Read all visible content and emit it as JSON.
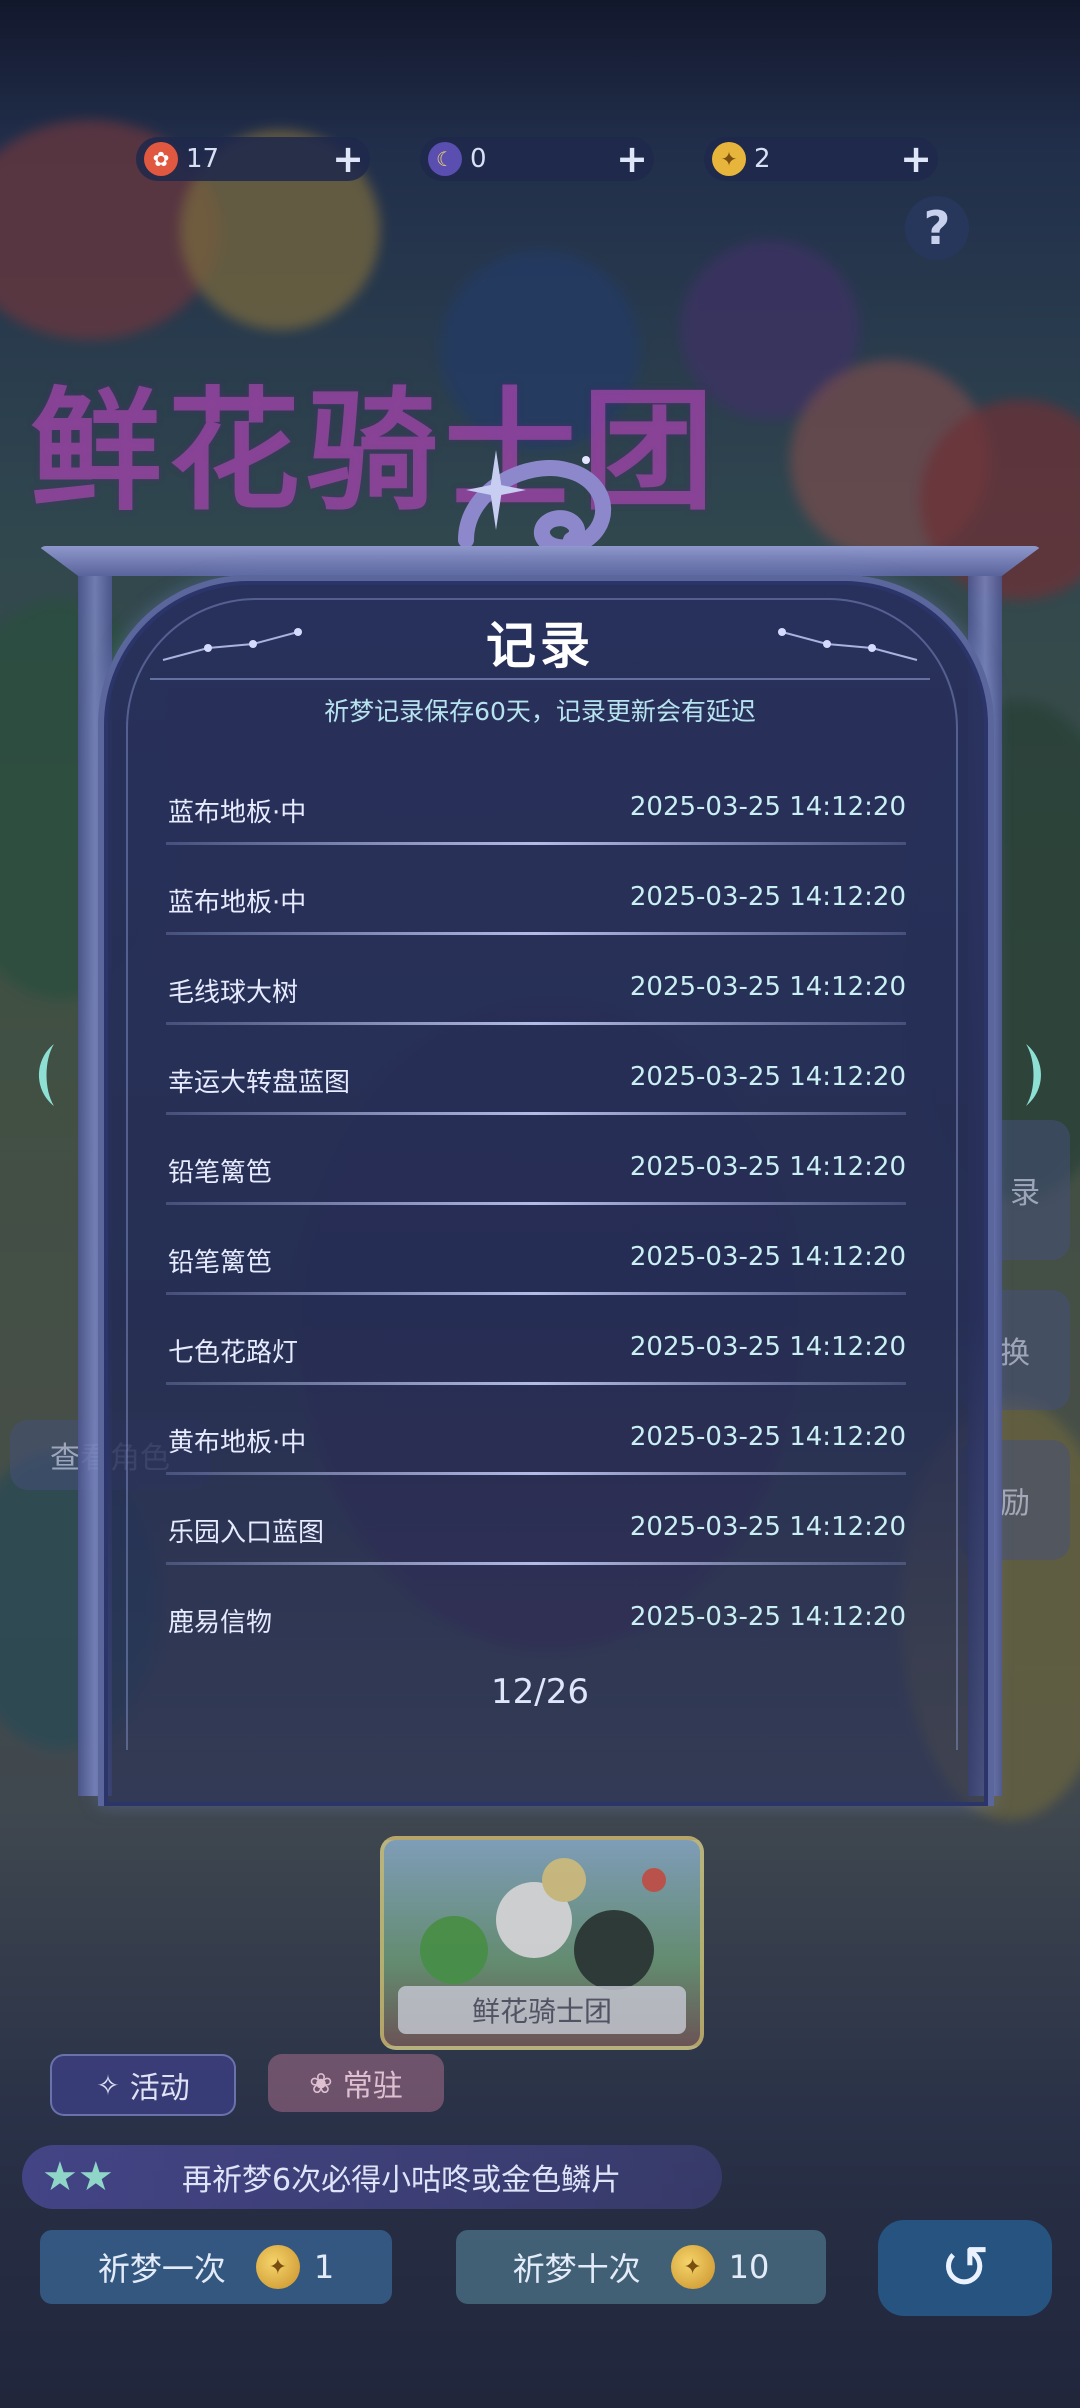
{
  "currency": [
    {
      "icon": "flower-coin-icon",
      "value": "17"
    },
    {
      "icon": "moon-coin-icon",
      "value": "0"
    },
    {
      "icon": "gold-scale-icon",
      "value": "2"
    }
  ],
  "banner": {
    "title": "鲜花骑士团"
  },
  "side": {
    "left_chip": "查看角色",
    "right_records": "录",
    "right_exchange": "换",
    "right_reward": "励"
  },
  "modal": {
    "title": "记录",
    "subtitle": "祈梦记录保存60天，记录更新会有延迟",
    "records": [
      {
        "name": "蓝布地板·中",
        "time": "2025-03-25 14:12:20"
      },
      {
        "name": "蓝布地板·中",
        "time": "2025-03-25 14:12:20"
      },
      {
        "name": "毛线球大树",
        "time": "2025-03-25 14:12:20"
      },
      {
        "name": "幸运大转盘蓝图",
        "time": "2025-03-25 14:12:20"
      },
      {
        "name": "铅笔篱笆",
        "time": "2025-03-25 14:12:20"
      },
      {
        "name": "铅笔篱笆",
        "time": "2025-03-25 14:12:20"
      },
      {
        "name": "七色花路灯",
        "time": "2025-03-25 14:12:20"
      },
      {
        "name": "黄布地板·中",
        "time": "2025-03-25 14:12:20"
      },
      {
        "name": "乐园入口蓝图",
        "time": "2025-03-25 14:12:20"
      },
      {
        "name": "鹿易信物",
        "time": "2025-03-25 14:12:20"
      }
    ],
    "pager": "12/26"
  },
  "pool": {
    "label": "鲜花骑士团"
  },
  "tabs": {
    "activity": "活动",
    "regular": "常驻"
  },
  "tip": "再祈梦6次必得小咕咚或金色鳞片",
  "actions": {
    "pray_once": "祈梦一次",
    "pray_once_cost": "1",
    "pray_ten": "祈梦十次",
    "pray_ten_cost": "10"
  },
  "colors": {
    "accent": "#5a669c",
    "time_text": "#c9eff2",
    "subtitle": "#b7e3ee"
  }
}
